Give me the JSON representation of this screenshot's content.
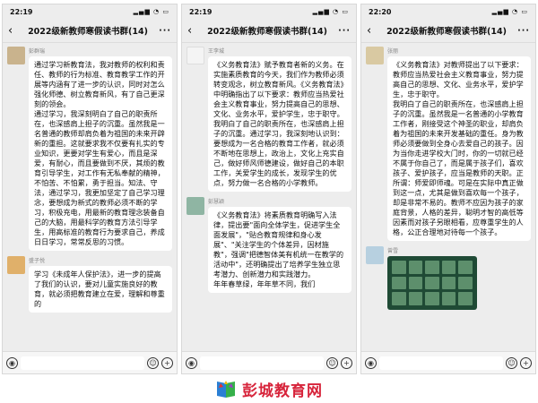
{
  "phones": [
    {
      "status": {
        "time": "22:19"
      },
      "title": "2022级新教师寒假读书群(14)",
      "messages": [
        {
          "sender": "彭群瑞",
          "text": "通过学习新教育法，我对教师的权利和责任、教师的行为标准、教育教学工作的开展等内涵有了进一步的认识，同时对怎么强化师德、树立教育新风，有了自己更深刻的领会。\n通过学习，我深刻明白了自己的职责所在，也深感肩上担子的沉重。虽然我是一名普通的教师却肩负着为祖国的未来开辟新的重担。这就要求我不仅要有扎实的专业知识，更要对学生有爱心，而且是深爱，有耐心，而且要做到不厌，其烦的教育引导学生，对工作有无私奉献的精神，不怕苦、不怕累，勇于担当。知法、守法，通过学习，我更加坚定了自己学习理念，要想成为新式的教师必须不断的学习，积极充电，用最新的教育理念装备自己的大脑，用最科学的教育方法引导学生，用高标准的教育行为要求自己，养成日日学习，常常反思的习惯。"
        },
        {
          "sender": "盛子悦",
          "text": "学习《未成年人保护法》，进一步的提高了我们的认识，要对儿童实施良好的教育，就必须把教育建立在爱，理解和尊重的"
        }
      ]
    },
    {
      "status": {
        "time": "22:19"
      },
      "title": "2022级新教师寒假读书群(14)",
      "messages": [
        {
          "sender": "王李城",
          "text": "《义务教育法》赋予教育者新的义务。在实施素质教育的今天，我们作为教师必须转变观念，树立教育新风。《义务教育法》中明确指出了以下要求：教师应当热爱社会主义教育事业，努力提高自己的思想、文化、业务水平，爱护学生，忠于职守。我明白了自己的职责所在，也深感肩上担子的沉重。通过学习，我深刻地认识到：要想成为一名合格的教育工作者，就必须不断地在思想上，政治上，文化上充实自己，做好师风师德建设，做好自己的本职工作，关爱学生的成长，发现学生的优点，努力做一名合格的小学教师。"
        },
        {
          "sender": "彭慧颖",
          "text": "《义务教育法》将素质教育明确写入法律，提出要\"面向全体学生，促进学生全面发展\"，\"贴合教育规律和身心发展\"、\"关注学生的个体差异，因材施教\"，强调\"把德智体美有机统一在教学的活动中\"，还明确提出了培养学生独立思考潜力、创新潜力和实践潜力。\n年年春草绿，年年草不同，我们"
        }
      ]
    },
    {
      "status": {
        "time": "22:20"
      },
      "title": "2022级新教师寒假读书群(14)",
      "messages": [
        {
          "sender": "张丽",
          "text": "《义务教育法》对教师提出了以下要求：教师应当热爱社会主义教育事业，努力提高自己的思想、文化、业务水平，爱护学生，忠于职守。\n我明白了自己的职责所在，也深感肩上担子的沉重。虽然我是一名普通的小学教育工作者，刚接受这个神圣的职业，却肩负着为祖国的未来开发基础的重任。身为教师必须要做到全身心去爱自己的孩子。因为当你走进学校大门时，你的一切就已经不属于你自己了，而是属于孩子们，喜欢孩子、爱护孩子，应当是教师的天职。正所谓：师爱即师魂。可是在实际中真正做到这一点，尤其是做到喜欢每一个孩子，却是非常不易的。教师不应因为孩子的家庭背景，人格的差异，聪明才智的高低等因素而对孩子另眼相看，应尊重学生的人格，公正合理地对待每一个孩子。"
        },
        {
          "sender": "曾雪",
          "text": ""
        }
      ]
    }
  ],
  "brand": {
    "text": "彭城教育网"
  }
}
